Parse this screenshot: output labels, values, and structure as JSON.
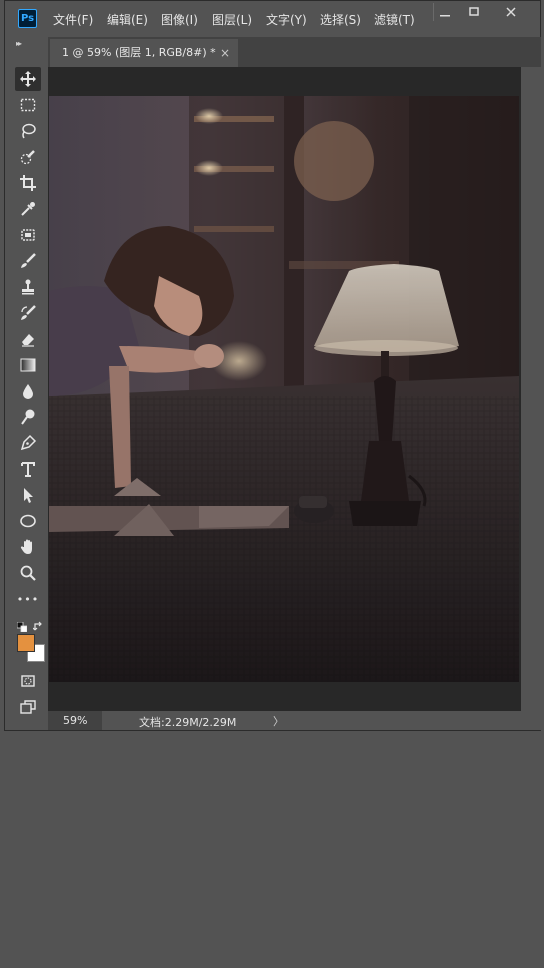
{
  "app": {
    "logo": "Ps"
  },
  "menu": [
    "文件(F)",
    "编辑(E)",
    "图像(I)",
    "图层(L)",
    "文字(Y)",
    "选择(S)",
    "滤镜(T)"
  ],
  "document": {
    "tab_title": "1 @ 59% (图层 1, RGB/8#) *",
    "close_glyph": "×"
  },
  "status": {
    "zoom": "59%",
    "doc_info": "文档:2.29M/2.29M",
    "arrow": "〉"
  },
  "toolbar": {
    "collapse": "▸▸",
    "more": "•••"
  },
  "colors": {
    "foreground": "#e4913f",
    "background": "#ffffff",
    "accent": "#31a8ff"
  },
  "icons": [
    "move-icon",
    "marquee-icon",
    "lasso-icon",
    "quick-select-icon",
    "crop-icon",
    "eyedropper-icon",
    "patch-icon",
    "brush-icon",
    "stamp-icon",
    "history-brush-icon",
    "eraser-icon",
    "gradient-icon",
    "blur-icon",
    "dodge-icon",
    "pen-icon",
    "type-icon",
    "path-select-icon",
    "ellipse-icon",
    "hand-icon",
    "zoom-icon",
    "more-icon",
    "default-colors-icon",
    "swap-colors-icon",
    "quick-mask-icon",
    "screen-mode-icon"
  ]
}
